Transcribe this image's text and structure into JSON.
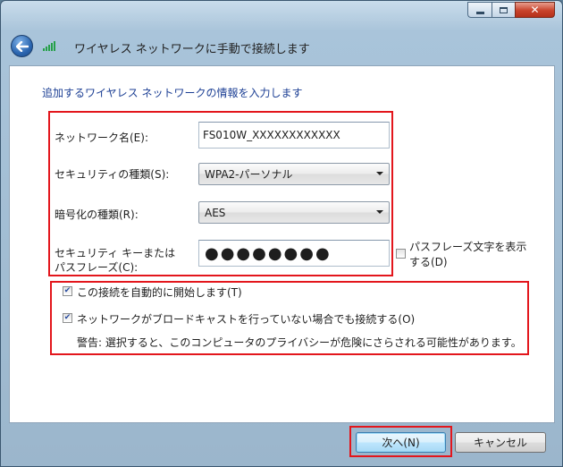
{
  "window": {
    "title": "ワイヤレス ネットワークに手動で接続します",
    "caption": {
      "minimize": "minimize",
      "maximize": "maximize",
      "close": "✕"
    }
  },
  "content": {
    "instruction": "追加するワイヤレス ネットワークの情報を入力します",
    "network_name": {
      "label": "ネットワーク名(E):",
      "value": "FS010W_XXXXXXXXXXXX"
    },
    "security_type": {
      "label": "セキュリティの種類(S):",
      "value": "WPA2-パーソナル"
    },
    "encryption_type": {
      "label": "暗号化の種類(R):",
      "value": "AES"
    },
    "security_key": {
      "label_line1": "セキュリティ キーまたは",
      "label_line2": "パスフレーズ(C):",
      "value": "●●●●●●●●"
    },
    "show_characters": {
      "label_line1": "パスフレーズ文字を表示",
      "label_line2": "する(D)",
      "checked": false
    },
    "auto_start": {
      "label": "この接続を自動的に開始します(T)",
      "checked": true
    },
    "connect_hidden": {
      "label": "ネットワークがブロードキャストを行っていない場合でも接続する(O)",
      "checked": true
    },
    "warning": "警告: 選択すると、このコンピュータのプライバシーが危険にさらされる可能性があります。"
  },
  "footer": {
    "next_label": "次へ(N)",
    "cancel_label": "キャンセル"
  },
  "colors": {
    "highlight": "#e3161c",
    "instruction_text": "#1c3f94"
  },
  "icons": [
    "back-arrow-icon",
    "wireless-signal-icon",
    "minimize-icon",
    "maximize-icon",
    "close-icon",
    "dropdown-arrow-icon",
    "checkmark-icon"
  ]
}
